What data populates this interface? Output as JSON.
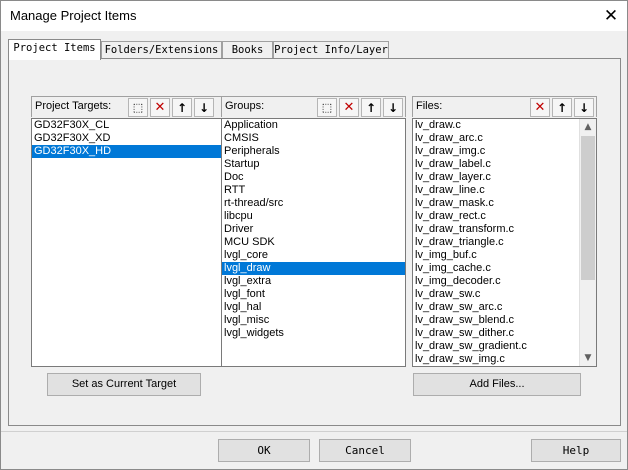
{
  "window": {
    "title": "Manage Project Items",
    "close_glyph": "✕"
  },
  "tabs": [
    {
      "label": "Project Items"
    },
    {
      "label": "Folders/Extensions"
    },
    {
      "label": "Books"
    },
    {
      "label": "Project Info/Layer"
    }
  ],
  "targets": {
    "label": "Project Targets:",
    "items": [
      "GD32F30X_CL",
      "GD32F30X_XD",
      "GD32F30X_HD"
    ],
    "selected": "GD32F30X_HD",
    "set_current_label": "Set as Current Target"
  },
  "groups": {
    "label": "Groups:",
    "items": [
      "Application",
      "CMSIS",
      "Peripherals",
      "Startup",
      "Doc",
      "RTT",
      "rt-thread/src",
      "libcpu",
      "Driver",
      "MCU SDK",
      "lvgl_core",
      "lvgl_draw",
      "lvgl_extra",
      "lvgl_font",
      "lvgl_hal",
      "lvgl_misc",
      "lvgl_widgets"
    ],
    "selected": "lvgl_draw"
  },
  "files": {
    "label": "Files:",
    "items": [
      "lv_draw.c",
      "lv_draw_arc.c",
      "lv_draw_img.c",
      "lv_draw_label.c",
      "lv_draw_layer.c",
      "lv_draw_line.c",
      "lv_draw_mask.c",
      "lv_draw_rect.c",
      "lv_draw_transform.c",
      "lv_draw_triangle.c",
      "lv_img_buf.c",
      "lv_img_cache.c",
      "lv_img_decoder.c",
      "lv_draw_sw.c",
      "lv_draw_sw_arc.c",
      "lv_draw_sw_blend.c",
      "lv_draw_sw_dither.c",
      "lv_draw_sw_gradient.c",
      "lv_draw_sw_img.c"
    ],
    "add_label": "Add Files..."
  },
  "footer": {
    "ok": "OK",
    "cancel": "Cancel",
    "help": "Help"
  },
  "colors": {
    "selection": "#0078d7",
    "delete_icon": "#c00000"
  }
}
